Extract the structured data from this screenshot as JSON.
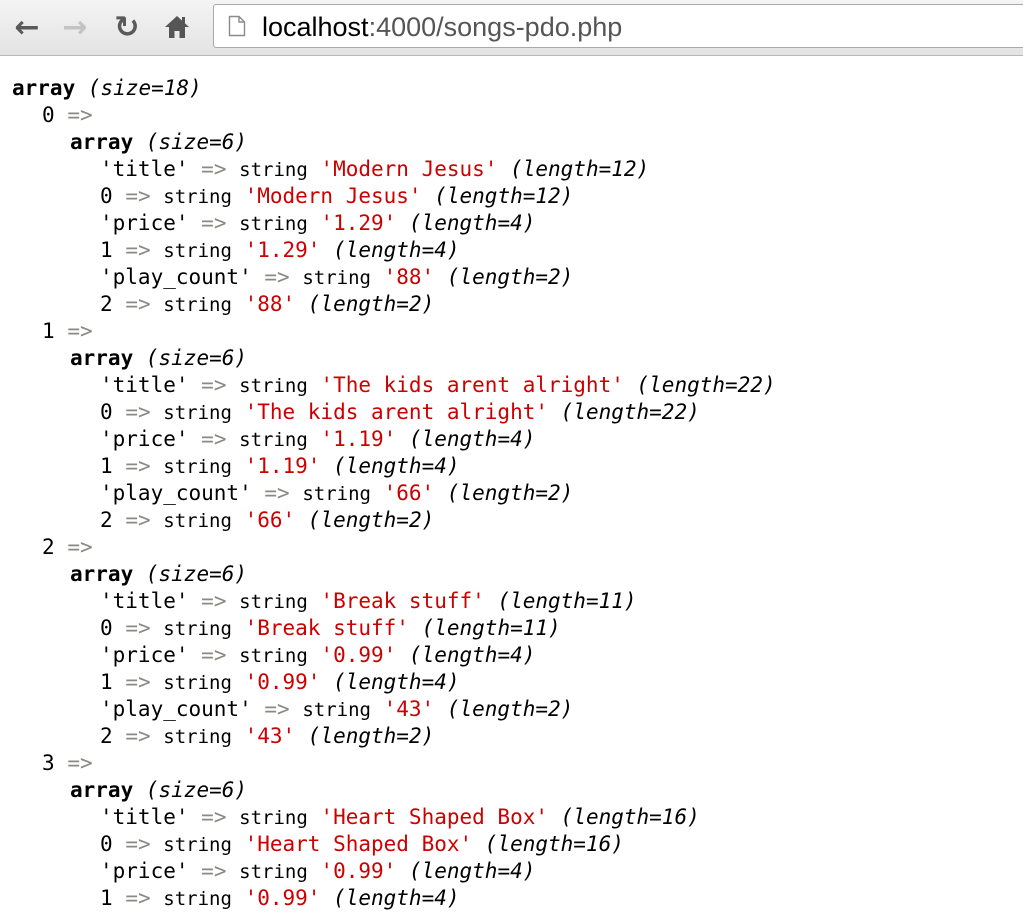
{
  "browser": {
    "url_host": "localhost",
    "url_rest": ":4000/songs-pdo.php",
    "icons": [
      "back-arrow-icon",
      "forward-arrow-icon",
      "reload-icon",
      "home-icon",
      "page-icon"
    ]
  },
  "dump": {
    "root_type": "array",
    "root_size": "(size=18)",
    "arrow": "=>",
    "type_label": "string",
    "items": [
      {
        "index": "0",
        "type": "array",
        "size": "(size=6)",
        "entries": [
          {
            "key": "'title'",
            "value": "'Modern Jesus'",
            "length": "(length=12)"
          },
          {
            "key": "0",
            "value": "'Modern Jesus'",
            "length": "(length=12)"
          },
          {
            "key": "'price'",
            "value": "'1.29'",
            "length": "(length=4)"
          },
          {
            "key": "1",
            "value": "'1.29'",
            "length": "(length=4)"
          },
          {
            "key": "'play_count'",
            "value": "'88'",
            "length": "(length=2)"
          },
          {
            "key": "2",
            "value": "'88'",
            "length": "(length=2)"
          }
        ]
      },
      {
        "index": "1",
        "type": "array",
        "size": "(size=6)",
        "entries": [
          {
            "key": "'title'",
            "value": "'The kids arent alright'",
            "length": "(length=22)"
          },
          {
            "key": "0",
            "value": "'The kids arent alright'",
            "length": "(length=22)"
          },
          {
            "key": "'price'",
            "value": "'1.19'",
            "length": "(length=4)"
          },
          {
            "key": "1",
            "value": "'1.19'",
            "length": "(length=4)"
          },
          {
            "key": "'play_count'",
            "value": "'66'",
            "length": "(length=2)"
          },
          {
            "key": "2",
            "value": "'66'",
            "length": "(length=2)"
          }
        ]
      },
      {
        "index": "2",
        "type": "array",
        "size": "(size=6)",
        "entries": [
          {
            "key": "'title'",
            "value": "'Break stuff'",
            "length": "(length=11)"
          },
          {
            "key": "0",
            "value": "'Break stuff'",
            "length": "(length=11)"
          },
          {
            "key": "'price'",
            "value": "'0.99'",
            "length": "(length=4)"
          },
          {
            "key": "1",
            "value": "'0.99'",
            "length": "(length=4)"
          },
          {
            "key": "'play_count'",
            "value": "'43'",
            "length": "(length=2)"
          },
          {
            "key": "2",
            "value": "'43'",
            "length": "(length=2)"
          }
        ]
      },
      {
        "index": "3",
        "type": "array",
        "size": "(size=6)",
        "entries": [
          {
            "key": "'title'",
            "value": "'Heart Shaped Box'",
            "length": "(length=16)"
          },
          {
            "key": "0",
            "value": "'Heart Shaped Box'",
            "length": "(length=16)"
          },
          {
            "key": "'price'",
            "value": "'0.99'",
            "length": "(length=4)"
          },
          {
            "key": "1",
            "value": "'0.99'",
            "length": "(length=4)"
          }
        ]
      }
    ]
  },
  "colors": {
    "string_value": "#cc0000",
    "arrow": "#888a85",
    "text": "#000000"
  }
}
